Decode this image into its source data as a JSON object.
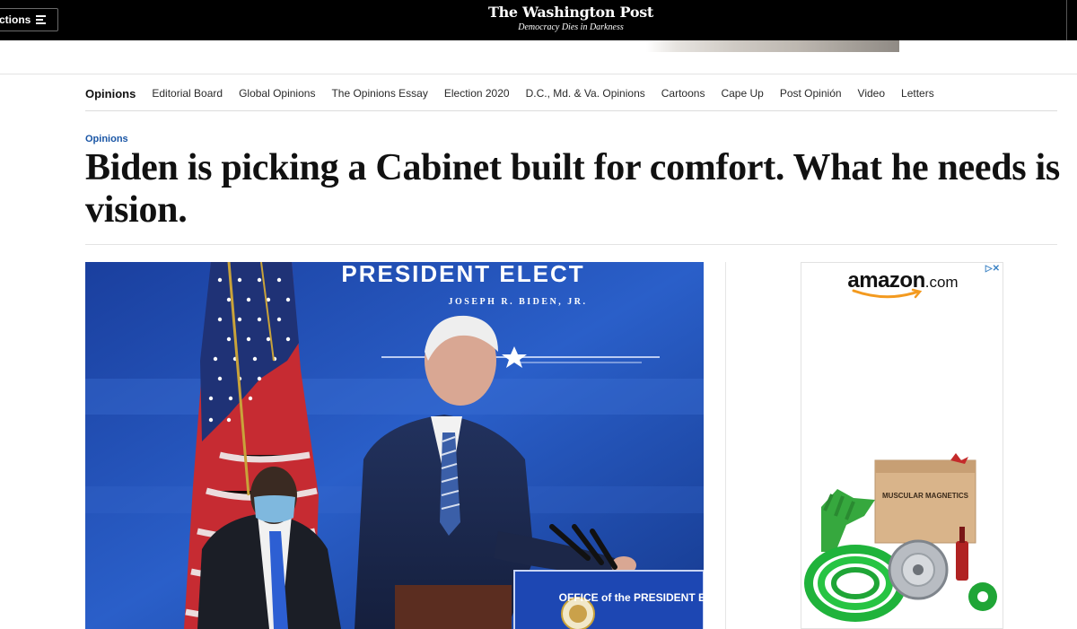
{
  "header": {
    "sections_label": "ctions",
    "logo": "The Washington Post",
    "tagline": "Democracy Dies in Darkness"
  },
  "nav": {
    "items": [
      "Opinions",
      "Editorial Board",
      "Global Opinions",
      "The Opinions Essay",
      "Election 2020",
      "D.C., Md. & Va. Opinions",
      "Cartoons",
      "Cape Up",
      "Post Opinión",
      "Video",
      "Letters"
    ]
  },
  "article": {
    "kicker": "Opinions",
    "headline": "Biden is picking a Cabinet built for comfort. What he needs is vision.",
    "photo": {
      "banner_title": "PRESIDENT ELECT",
      "banner_subtitle": "JOSEPH R. BIDEN, JR.",
      "podium_text": "OFFICE of the PRESIDENT ELECT"
    }
  },
  "ad": {
    "brand": "amazon",
    "brand_suffix": ".com",
    "adchoices": "▷✕",
    "product_box_label": "MUSCULAR MAGNETICS"
  },
  "colors": {
    "topbar": "#000000",
    "kicker": "#1955a5",
    "photo_blue": "#1b4fb8",
    "amazon_orange": "#f39a1f"
  }
}
